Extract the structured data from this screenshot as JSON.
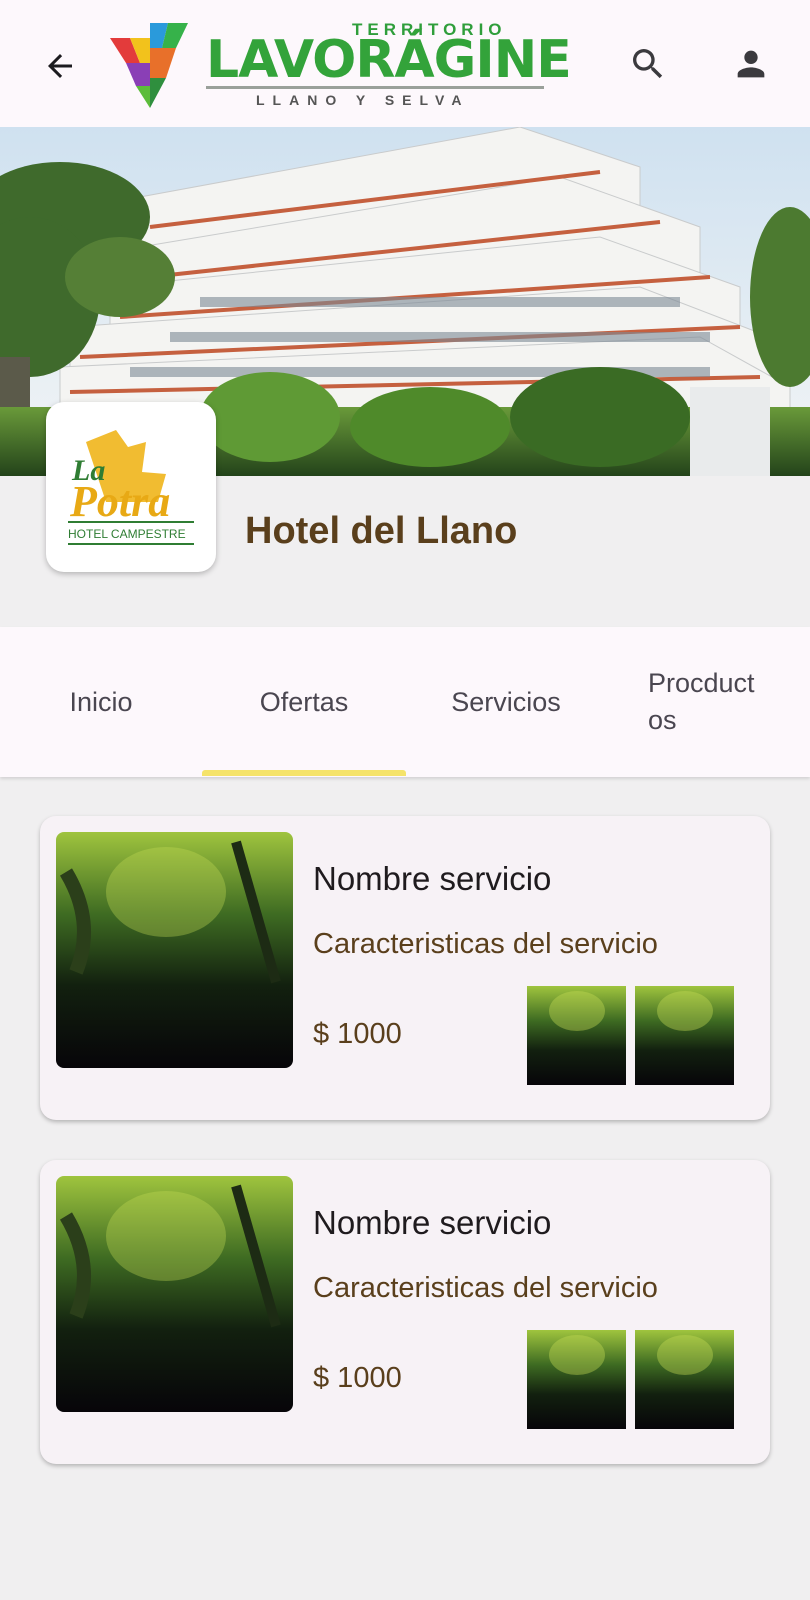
{
  "header": {
    "back_icon": "arrow-back-icon",
    "brand_top": "TERRITORIO",
    "brand_main": "LAVORÁGINE",
    "brand_sub": "LLANO Y SELVA",
    "search_icon": "search-icon",
    "account_icon": "account-icon"
  },
  "business": {
    "logo_line1": "La",
    "logo_line2": "Potra",
    "logo_line3": "HOTEL CAMPESTRE",
    "name": "Hotel del Llano"
  },
  "tabs": [
    {
      "label": "Inicio"
    },
    {
      "label": "Ofertas",
      "active": true
    },
    {
      "label": "Servicios"
    },
    {
      "label": "Procduct\nos"
    }
  ],
  "cards": [
    {
      "title": "Nombre servicio",
      "description": "Caracteristicas del servicio",
      "price": "$ 1000"
    },
    {
      "title": "Nombre servicio",
      "description": "Caracteristicas del servicio",
      "price": "$ 1000"
    }
  ],
  "colors": {
    "accent": "#f5e36a",
    "brown": "#5a3f1c",
    "brand_green": "#33a33a"
  }
}
